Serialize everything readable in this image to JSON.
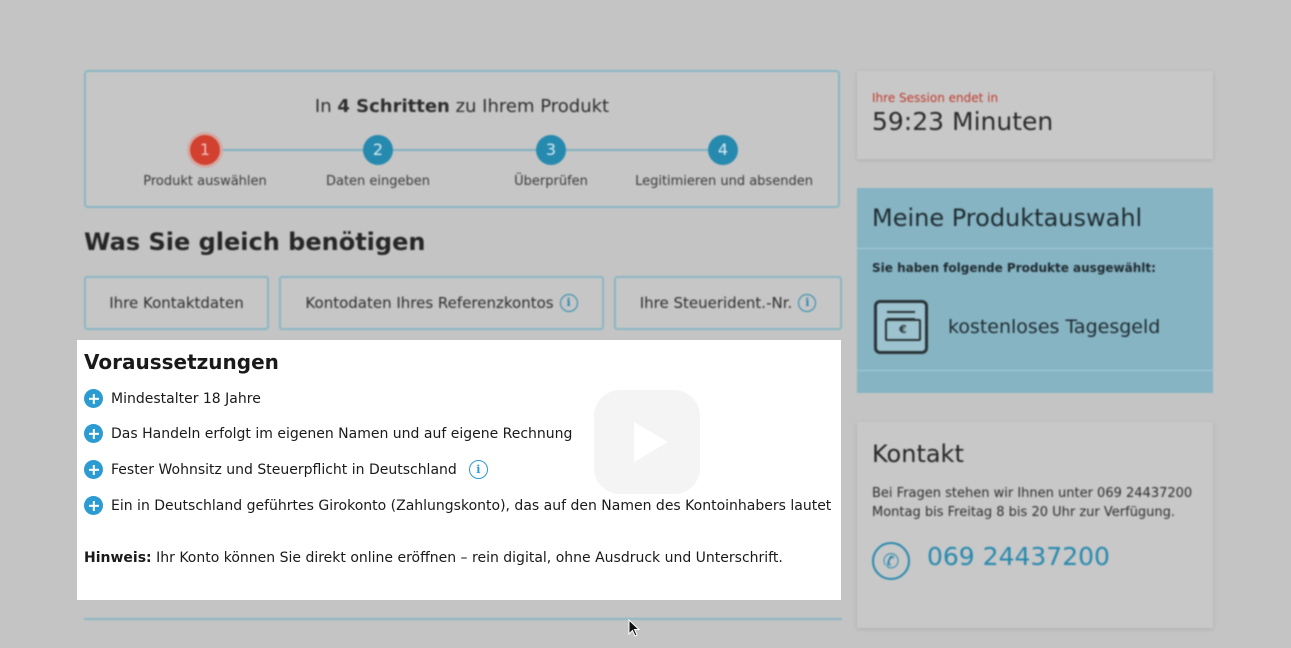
{
  "stepper": {
    "title_prefix": "In ",
    "title_bold": "4 Schritten",
    "title_suffix": " zu Ihrem Produkt",
    "steps": [
      {
        "number": "1",
        "label": "Produkt auswählen",
        "active": true
      },
      {
        "number": "2",
        "label": "Daten eingeben",
        "active": false
      },
      {
        "number": "3",
        "label": "Überprüfen",
        "active": false
      },
      {
        "number": "4",
        "label": "Legitimieren und absenden",
        "active": false
      }
    ]
  },
  "needs": {
    "heading": "Was Sie gleich benötigen",
    "items": [
      {
        "label": "Ihre Kontaktdaten"
      },
      {
        "label": "Kontodaten Ihres Referenzkontos"
      },
      {
        "label": "Ihre Steuerident.-Nr."
      }
    ]
  },
  "prerequisites": {
    "title": "Voraussetzungen",
    "items": [
      {
        "text": "Mindestalter 18 Jahre"
      },
      {
        "text": "Das Handeln erfolgt im eigenen Namen und auf eigene Rechnung"
      },
      {
        "text": "Fester Wohnsitz und Steuerpflicht in Deutschland"
      },
      {
        "text": "Ein in Deutschland geführtes Girokonto (Zahlungskonto), das auf den Namen des Kontoinhabers lautet"
      }
    ],
    "hint_label": "Hinweis:",
    "hint_text": " Ihr Konto können Sie direkt online eröffnen – rein digital, ohne Ausdruck und Unterschrift."
  },
  "session": {
    "label": "Ihre Session endet in",
    "time": "59:23 Minuten"
  },
  "product_selection": {
    "title": "Meine Produktauswahl",
    "subtitle": "Sie haben folgende Produkte ausgewählt:",
    "product_name": "kostenloses Tagesgeld",
    "icon_symbol": "€"
  },
  "contact": {
    "title": "Kontakt",
    "text_line1": "Bei Fragen stehen wir Ihnen unter 069 24437200",
    "text_line2": "Montag bis Freitag 8 bis 20 Uhr zur Verfügung.",
    "phone": "069 24437200",
    "phone_icon": "✆"
  },
  "icons": {
    "info": "i",
    "accent_color": "#2689ae",
    "active_step_color": "#d2402f"
  }
}
